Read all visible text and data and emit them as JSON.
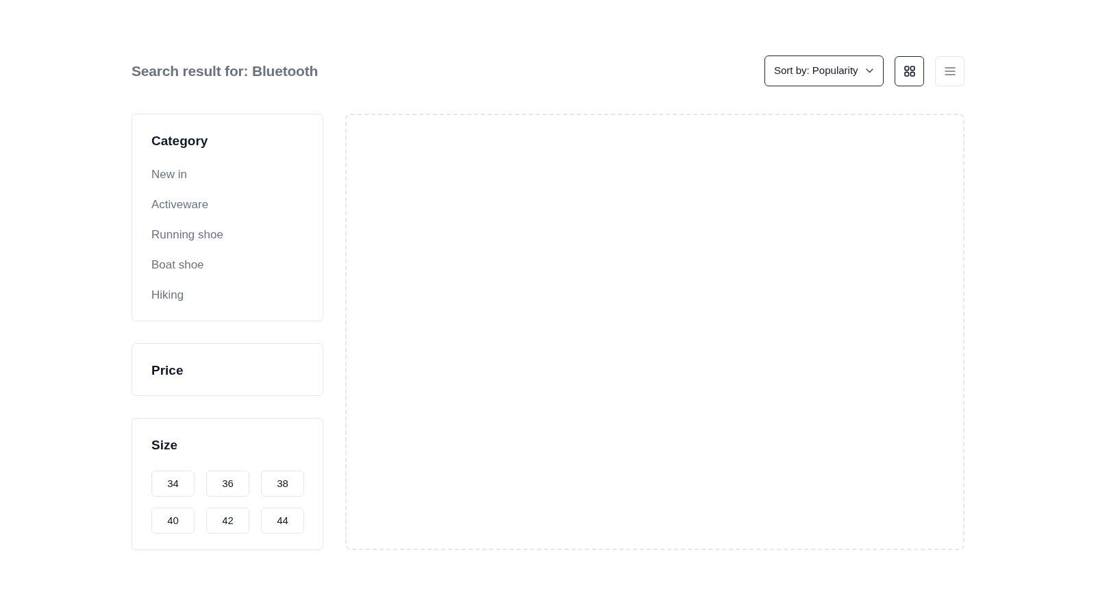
{
  "header": {
    "text": "Search result for: **Bluetooth**"
  },
  "sort": {
    "value": "Sort by: Popularity"
  },
  "view_toggles": [
    {
      "kind": "grid",
      "selected": true
    },
    {
      "kind": "list",
      "selected": false
    }
  ],
  "filters": [
    {
      "kind": "list",
      "title": "Category",
      "items": [
        {
          "label": "New in",
          "selected": false
        },
        {
          "label": "Activeware",
          "selected": false
        },
        {
          "label": "Running shoe",
          "selected": false
        },
        {
          "label": "Boat shoe",
          "selected": false
        },
        {
          "label": "Hiking",
          "selected": false
        }
      ]
    },
    {
      "kind": "plain",
      "title": "Price"
    },
    {
      "kind": "sizes",
      "title": "Size",
      "options": [
        {
          "label": "34",
          "selected": false
        },
        {
          "label": "36",
          "selected": false
        },
        {
          "label": "38",
          "selected": false
        },
        {
          "label": "40",
          "selected": false
        },
        {
          "label": "42",
          "selected": false
        },
        {
          "label": "44",
          "selected": false
        }
      ]
    }
  ]
}
